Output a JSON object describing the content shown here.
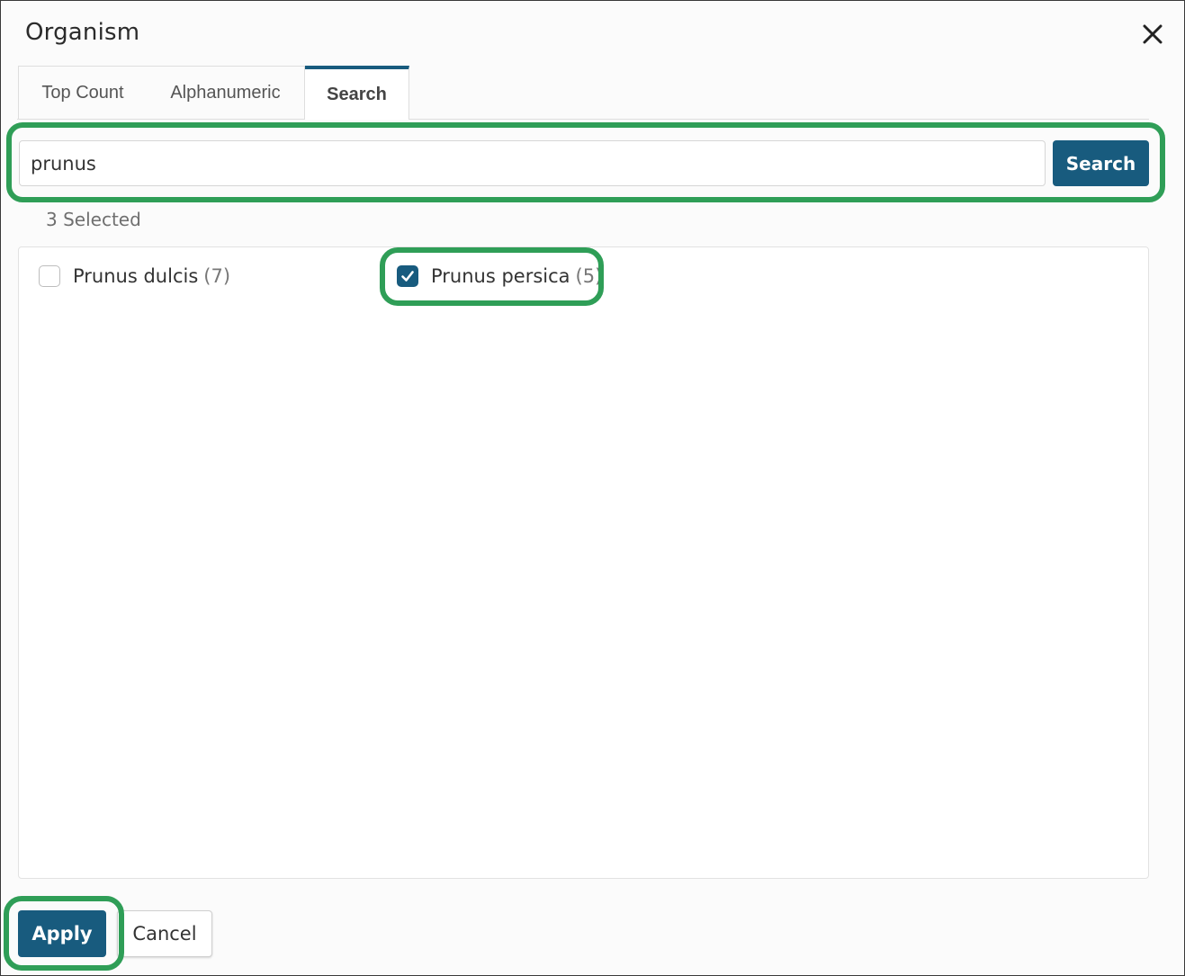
{
  "dialog": {
    "title": "Organism",
    "close_icon": "close-icon"
  },
  "tabs": [
    {
      "label": "Top Count",
      "active": false
    },
    {
      "label": "Alphanumeric",
      "active": false
    },
    {
      "label": "Search",
      "active": true
    }
  ],
  "search": {
    "value": "prunus",
    "button_label": "Search"
  },
  "selection": {
    "count_text": "3 Selected"
  },
  "results": [
    {
      "label": "Prunus dulcis",
      "count": "(7)",
      "checked": false
    },
    {
      "label": "Prunus persica",
      "count": "(5)",
      "checked": true
    }
  ],
  "footer": {
    "apply_label": "Apply",
    "cancel_label": "Cancel"
  },
  "colors": {
    "accent": "#185b7e",
    "highlight": "#2f9e57"
  }
}
